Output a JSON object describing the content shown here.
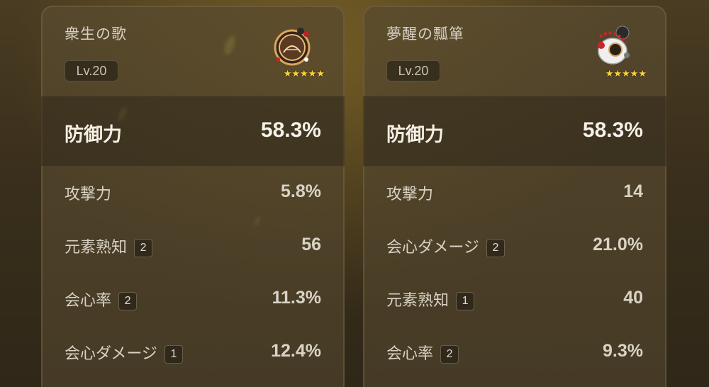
{
  "artifacts": [
    {
      "title": "衆生の歌",
      "level": "Lv.20",
      "icon": "pocket-watch-icon",
      "stars": "★★★★★",
      "main_stat": {
        "name": "防御力",
        "value": "58.3%"
      },
      "sub_stats": [
        {
          "name": "攻撃力",
          "badge": "",
          "value": "5.8%"
        },
        {
          "name": "元素熟知",
          "badge": "2",
          "value": "56"
        },
        {
          "name": "会心率",
          "badge": "2",
          "value": "11.3%"
        },
        {
          "name": "会心ダメージ",
          "badge": "1",
          "value": "12.4%"
        }
      ]
    },
    {
      "title": "夢醒の瓢箪",
      "level": "Lv.20",
      "icon": "gourd-icon",
      "stars": "★★★★★",
      "main_stat": {
        "name": "防御力",
        "value": "58.3%"
      },
      "sub_stats": [
        {
          "name": "攻撃力",
          "badge": "",
          "value": "14"
        },
        {
          "name": "会心ダメージ",
          "badge": "2",
          "value": "21.0%"
        },
        {
          "name": "元素熟知",
          "badge": "1",
          "value": "40"
        },
        {
          "name": "会心率",
          "badge": "2",
          "value": "9.3%"
        }
      ]
    }
  ],
  "colors": {
    "star": "#ffd13a",
    "card_bg": "#584a2e",
    "background": "#3a2f1c"
  }
}
